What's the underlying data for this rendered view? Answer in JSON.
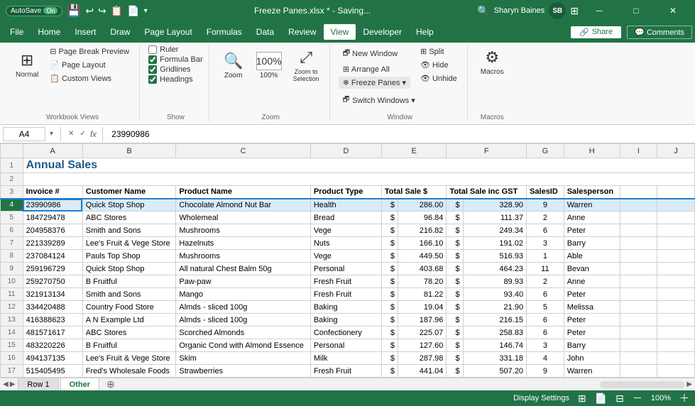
{
  "title_bar": {
    "autosave_label": "AutoSave",
    "autosave_state": "On",
    "filename": "Freeze Panes.xlsx",
    "saving": "* - Saving...",
    "user": "Sharyn Baines",
    "user_initials": "SB",
    "window_controls": [
      "─",
      "□",
      "✕"
    ]
  },
  "menu": {
    "items": [
      "File",
      "Home",
      "Insert",
      "Draw",
      "Page Layout",
      "Formulas",
      "Data",
      "Review",
      "View",
      "Developer",
      "Help"
    ]
  },
  "ribbon": {
    "groups": [
      {
        "label": "Workbook Views",
        "buttons": [
          "Normal",
          "Page Break Preview",
          "Page Layout",
          "Custom Views"
        ]
      },
      {
        "label": "Show",
        "checkboxes": [
          "Ruler",
          "Formula Bar",
          "Gridlines",
          "Headings"
        ]
      },
      {
        "label": "Zoom",
        "buttons": [
          "Zoom",
          "100%",
          "Zoom to Selection"
        ]
      },
      {
        "label": "",
        "buttons": [
          "New Window",
          "Arrange All",
          "Freeze Panes ▾",
          "Split",
          "Hide",
          "Unhide",
          "Switch Windows ▾"
        ]
      },
      {
        "label": "Macros",
        "buttons": [
          "Macros"
        ]
      }
    ]
  },
  "formula_bar": {
    "cell_ref": "A4",
    "formula_label": "fx",
    "value": "23990986"
  },
  "spreadsheet": {
    "title": "Annual Sales",
    "columns": [
      "A",
      "B",
      "C",
      "D",
      "E",
      "",
      "F",
      "",
      "G",
      "H",
      "I",
      "J"
    ],
    "col_headers": [
      "Invoice #",
      "Customer Name",
      "Product Name",
      "Product Type",
      "Total Sale $",
      "",
      "Total Sale inc GST",
      "",
      "SalesID",
      "Salesperson",
      "",
      ""
    ],
    "rows": [
      {
        "num": "1",
        "cells": [
          "Annual Sales",
          "",
          "",
          "",
          "",
          "",
          "",
          "",
          "",
          "",
          "",
          ""
        ]
      },
      {
        "num": "2",
        "cells": [
          "",
          "",
          "",
          "",
          "",
          "",
          "",
          "",
          "",
          "",
          "",
          ""
        ]
      },
      {
        "num": "3",
        "cells": [
          "Invoice #",
          "Customer Name",
          "Product Name",
          "Product Type",
          "Total Sale $",
          "",
          "Total Sale inc GST",
          "",
          "SalesID",
          "Salesperson",
          "",
          ""
        ]
      },
      {
        "num": "4",
        "cells": [
          "23990986",
          "Quick Stop Shop",
          "Chocolate Almond Nut Bar",
          "Health",
          "$",
          "286.00",
          "$",
          "328.90",
          "9",
          "Warren",
          "",
          ""
        ],
        "active": true
      },
      {
        "num": "5",
        "cells": [
          "184729478",
          "ABC Stores",
          "Wholemeal",
          "Bread",
          "$",
          "96.84",
          "$",
          "111.37",
          "2",
          "Anne",
          "",
          ""
        ]
      },
      {
        "num": "6",
        "cells": [
          "204958376",
          "Smith and Sons",
          "Mushrooms",
          "Vege",
          "$",
          "216.82",
          "$",
          "249.34",
          "6",
          "Peter",
          "",
          ""
        ]
      },
      {
        "num": "7",
        "cells": [
          "221339289",
          "Lee's Fruit & Vege Store",
          "Hazelnuts",
          "Nuts",
          "$",
          "166.10",
          "$",
          "191.02",
          "3",
          "Barry",
          "",
          ""
        ]
      },
      {
        "num": "8",
        "cells": [
          "237084124",
          "Pauls Top Shop",
          "Mushrooms",
          "Vege",
          "$",
          "449.50",
          "$",
          "516.93",
          "1",
          "Able",
          "",
          ""
        ]
      },
      {
        "num": "9",
        "cells": [
          "259196729",
          "Quick Stop Shop",
          "All natural Chest Balm 50g",
          "Personal",
          "$",
          "403.68",
          "$",
          "464.23",
          "11",
          "Bevan",
          "",
          ""
        ]
      },
      {
        "num": "10",
        "cells": [
          "259270750",
          "B Fruitful",
          "Paw-paw",
          "Fresh Fruit",
          "$",
          "78.20",
          "$",
          "89.93",
          "2",
          "Anne",
          "",
          ""
        ]
      },
      {
        "num": "11",
        "cells": [
          "321913134",
          "Smith and Sons",
          "Mango",
          "Fresh Fruit",
          "$",
          "81.22",
          "$",
          "93.40",
          "6",
          "Peter",
          "",
          ""
        ]
      },
      {
        "num": "12",
        "cells": [
          "334420488",
          "Country Food Store",
          "Almds - sliced 100g",
          "Baking",
          "$",
          "19.04",
          "$",
          "21.90",
          "5",
          "Melissa",
          "",
          ""
        ]
      },
      {
        "num": "13",
        "cells": [
          "416388623",
          "A N Example Ltd",
          "Almds - sliced 100g",
          "Baking",
          "$",
          "187.96",
          "$",
          "216.15",
          "6",
          "Peter",
          "",
          ""
        ]
      },
      {
        "num": "14",
        "cells": [
          "481571617",
          "ABC Stores",
          "Scorched Almonds",
          "Confectionery",
          "$",
          "225.07",
          "$",
          "258.83",
          "6",
          "Peter",
          "",
          ""
        ]
      },
      {
        "num": "15",
        "cells": [
          "483220226",
          "B Fruitful",
          "Organic Cond with Almond Essence",
          "Personal",
          "$",
          "127.60",
          "$",
          "146.74",
          "3",
          "Barry",
          "",
          ""
        ]
      },
      {
        "num": "16",
        "cells": [
          "494137135",
          "Lee's Fruit & Vege Store",
          "Skim",
          "Milk",
          "$",
          "287.98",
          "$",
          "331.18",
          "4",
          "John",
          "",
          ""
        ]
      },
      {
        "num": "17",
        "cells": [
          "515405495",
          "Fred's Wholesale Foods",
          "Strawberries",
          "Fresh Fruit",
          "$",
          "441.04",
          "$",
          "507.20",
          "9",
          "Warren",
          "",
          ""
        ]
      }
    ]
  },
  "sheet_tabs": {
    "tabs": [
      "Row 1",
      "Other"
    ],
    "active": "Other"
  },
  "status_bar": {
    "cell_mode": "",
    "display_settings": "Display Settings"
  }
}
